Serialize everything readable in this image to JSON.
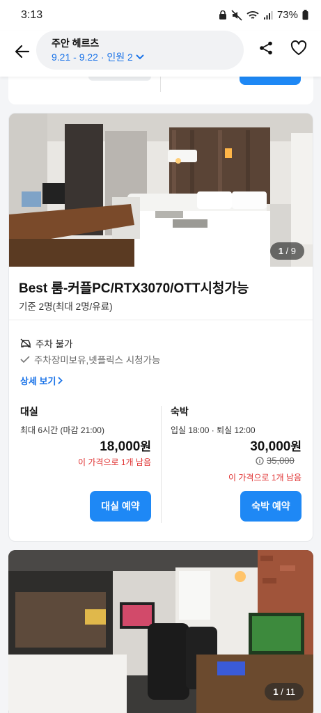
{
  "status": {
    "time": "3:13",
    "battery": "73%"
  },
  "header": {
    "place": "주안 헤르츠",
    "dates_guests": "9.21 - 9.22 · 인원 2"
  },
  "room": {
    "image_counter_current": "1",
    "image_counter_total": "9",
    "title": "Best 룸-커플PC/RTX3070/OTT시청가능",
    "capacity": "기준 2명(최대 2명/유료)",
    "amenity_parking": "주차 불가",
    "amenity_note": "주차장미보유,넷플릭스 시청가능",
    "details_link": "상세 보기",
    "rental": {
      "label": "대실",
      "info": "최대 6시간 (마감 21:00)",
      "price": "18,000",
      "won": "원",
      "remaining": "이 가격으로 1개 남음",
      "button": "대실 예약"
    },
    "stay": {
      "label": "숙박",
      "info": "입실 18:00 · 퇴실 12:00",
      "price": "30,000",
      "won": "원",
      "original_price": "35,000",
      "remaining": "이 가격으로 1개 남음",
      "button": "숙박 예약"
    }
  },
  "next_room": {
    "image_counter_current": "1",
    "image_counter_total": "11"
  },
  "colors": {
    "accent": "#1e88f5",
    "warning": "#e03131"
  }
}
